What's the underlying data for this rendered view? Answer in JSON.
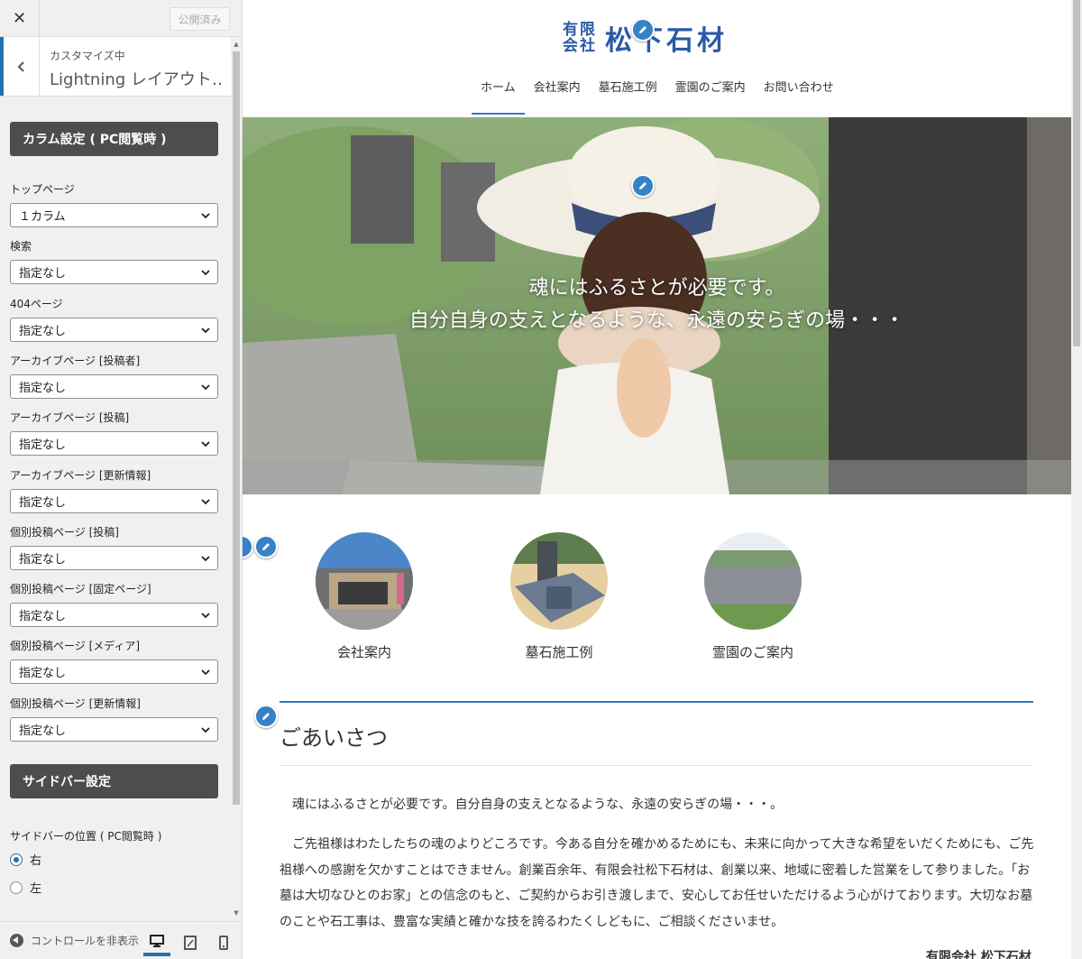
{
  "customizer": {
    "close_icon": "close-icon",
    "publish_label": "公開済み",
    "section_subtitle": "カスタマイズ中",
    "section_title": "Lightning レイアウト…",
    "column_heading": "カラム設定 ( PC閲覧時 )",
    "controls": [
      {
        "label": "トップページ",
        "value": "１カラム"
      },
      {
        "label": "検索",
        "value": "指定なし"
      },
      {
        "label": "404ページ",
        "value": "指定なし"
      },
      {
        "label": "アーカイブページ [投稿者]",
        "value": "指定なし"
      },
      {
        "label": "アーカイブページ [投稿]",
        "value": "指定なし"
      },
      {
        "label": "アーカイブページ [更新情報]",
        "value": "指定なし"
      },
      {
        "label": "個別投稿ページ [投稿]",
        "value": "指定なし"
      },
      {
        "label": "個別投稿ページ [固定ページ]",
        "value": "指定なし"
      },
      {
        "label": "個別投稿ページ [メディア]",
        "value": "指定なし"
      },
      {
        "label": "個別投稿ページ [更新情報]",
        "value": "指定なし"
      }
    ],
    "sidebar_heading": "サイドバー設定",
    "sidebar_position_label": "サイドバーの位置 ( PC閲覧時 )",
    "sidebar_options": [
      {
        "label": "右",
        "checked": true
      },
      {
        "label": "左",
        "checked": false
      }
    ],
    "hide_controls_label": "コントロールを非表示",
    "devices": [
      "desktop",
      "tablet",
      "mobile"
    ],
    "accent_color": "#2271b1"
  },
  "site": {
    "logo_small_top": "有限",
    "logo_small_bottom": "会社",
    "logo_name": "松下石材",
    "brand_color": "#2a5aa6",
    "nav": [
      {
        "label": "ホーム",
        "active": true
      },
      {
        "label": "会社案内",
        "active": false
      },
      {
        "label": "墓石施工例",
        "active": false
      },
      {
        "label": "霊園のご案内",
        "active": false
      },
      {
        "label": "お問い合わせ",
        "active": false
      }
    ],
    "hero_line1": "魂にはふるさとが必要です。",
    "hero_line2": "自分自身の支えとなるような、永遠の安らぎの場・・・",
    "pr_blocks": [
      {
        "label": "会社案内"
      },
      {
        "label": "墓石施工例"
      },
      {
        "label": "霊園のご案内"
      }
    ],
    "greeting_title": "ごあいさつ",
    "paragraph1": "　魂にはふるさとが必要です。自分自身の支えとなるような、永遠の安らぎの場・・・。",
    "paragraph2": "　ご先祖様はわたしたちの魂のよりどころです。今ある自分を確かめるためにも、未来に向かって大きな希望をいだくためにも、ご先祖様への感謝を欠かすことはできません。創業百余年、有限会社松下石材は、創業以来、地域に密着した営業をして参りました。「お墓は大切なひとのお家」との信念のもと、ご契約からお引き渡しまで、安心してお任せいただけるよう心がけております。大切なお墓のことや石工事は、豊富な実績と確かな技を誇るわたくしどもに、ご相談くださいませ。",
    "signature": "有限会社 松下石材"
  }
}
